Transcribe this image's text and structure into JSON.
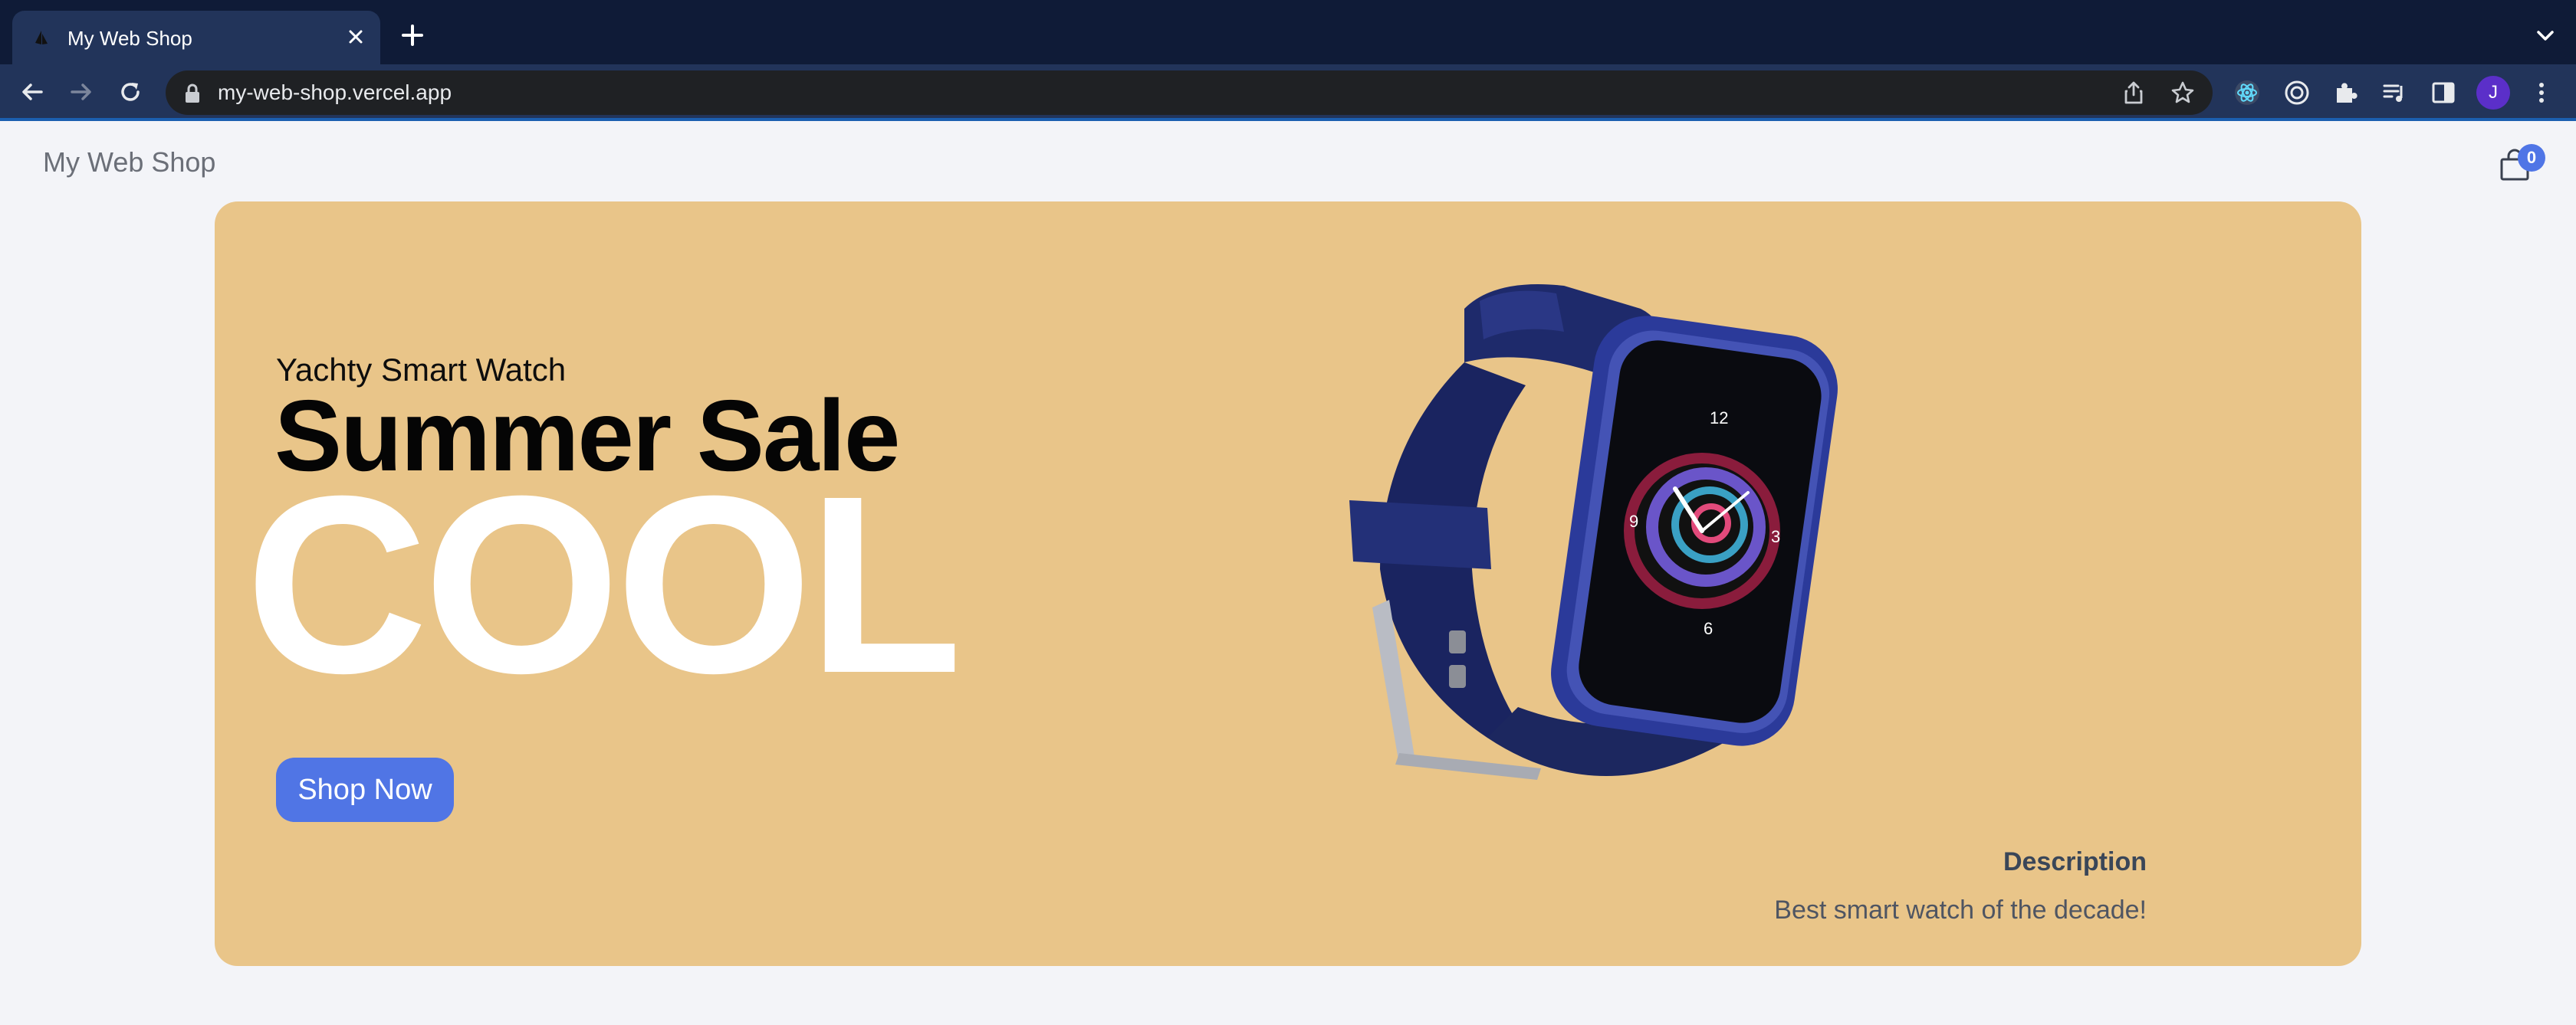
{
  "browser": {
    "tab_title": "My Web Shop",
    "url": "my-web-shop.vercel.app",
    "profile_initial": "J",
    "icons": {
      "favicon": "sailboat-icon",
      "close": "close-icon",
      "new_tab": "plus-icon",
      "tab_menu": "chevron-down-icon",
      "back": "arrow-left-icon",
      "forward": "arrow-right-icon",
      "reload": "reload-icon",
      "lock": "lock-icon",
      "share": "share-icon",
      "bookmark": "star-icon",
      "react_devtools": "react-icon",
      "extension_circle": "target-icon",
      "extensions": "puzzle-icon",
      "media": "playlist-icon",
      "side_panel": "sidepanel-icon",
      "menu": "kebab-icon"
    }
  },
  "header": {
    "brand": "My Web Shop",
    "cart_count": "0",
    "cart_icon": "shopping-bag-icon"
  },
  "hero": {
    "subtitle": "Yachty Smart Watch",
    "title": "Summer Sale",
    "big_text": "COOL",
    "button_label": "Shop Now",
    "description_label": "Description",
    "description_text": "Best smart watch of the decade!",
    "background_color": "#e9c589",
    "button_color": "#5075e5",
    "product_image": "smart-watch-image"
  }
}
